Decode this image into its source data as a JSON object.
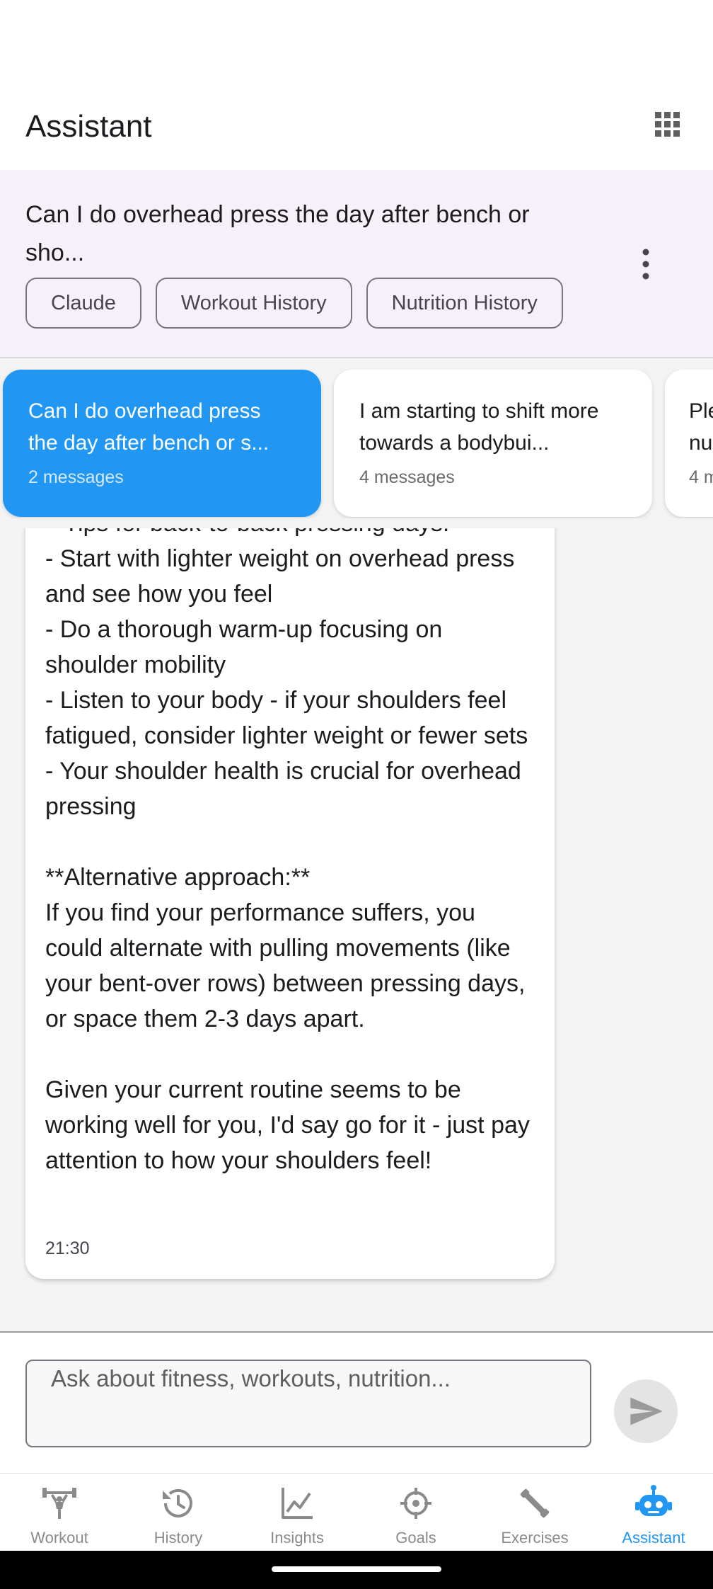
{
  "app_bar": {
    "title": "Assistant"
  },
  "conversation_header": {
    "title": "Can I do overhead press the day after bench or sho...",
    "chips": [
      {
        "label": "Claude"
      },
      {
        "label": "Workout History"
      },
      {
        "label": "Nutrition History"
      }
    ]
  },
  "conversations": [
    {
      "title": "Can I do overhead press the day after bench or s...",
      "count": "2 messages",
      "selected": true
    },
    {
      "title": "I am starting to shift more towards a bodybui...",
      "count": "4 messages",
      "selected": false
    },
    {
      "title": "Ple nu",
      "count": "4 m",
      "selected": false
    }
  ],
  "message": {
    "text": "**Tips for back-to-back pressing days:**\n- Start with lighter weight on overhead press and see how you feel\n- Do a thorough warm-up focusing on shoulder mobility\n- Listen to your body - if your shoulders feel fatigued, consider lighter weight or fewer sets\n- Your shoulder health is crucial for overhead pressing\n\n**Alternative approach:**\nIf you find your performance suffers, you could alternate with pulling movements (like your bent-over rows) between pressing days, or space them 2-3 days apart.\n\nGiven your current routine seems to be working well for you, I'd say go for it - just pay attention to how your shoulders feel!",
    "time": "21:30"
  },
  "composer": {
    "placeholder": "Ask about fitness, workouts, nutrition..."
  },
  "nav": {
    "items": [
      {
        "label": "Workout",
        "icon": "dumbbell-icon"
      },
      {
        "label": "History",
        "icon": "history-icon"
      },
      {
        "label": "Insights",
        "icon": "chart-icon"
      },
      {
        "label": "Goals",
        "icon": "target-icon"
      },
      {
        "label": "Exercises",
        "icon": "tools-icon"
      },
      {
        "label": "Assistant",
        "icon": "robot-icon",
        "active": true
      }
    ]
  },
  "colors": {
    "accent": "#2196f3",
    "header_bg": "#f6f1f8",
    "chat_bg": "#f3f3f3"
  }
}
